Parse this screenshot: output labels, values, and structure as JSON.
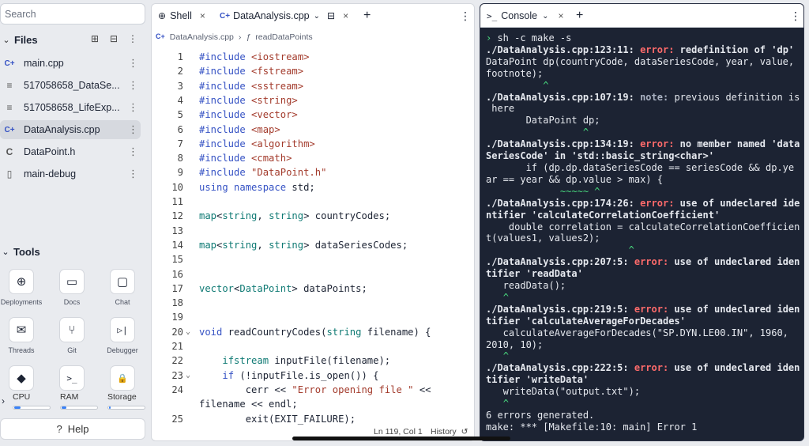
{
  "sidebar": {
    "search_placeholder": "Search",
    "files_title": "Files",
    "files": [
      {
        "icon": "cpp-icon",
        "glyph": "C+",
        "name": "main.cpp"
      },
      {
        "icon": "text-file-icon",
        "glyph": "≡",
        "name": "517058658_DataSe..."
      },
      {
        "icon": "text-file-icon",
        "glyph": "≡",
        "name": "517058658_LifeExp..."
      },
      {
        "icon": "cpp-icon",
        "glyph": "C+",
        "name": "DataAnalysis.cpp"
      },
      {
        "icon": "c-header-icon",
        "glyph": "C",
        "name": "DataPoint.h"
      },
      {
        "icon": "file-icon",
        "glyph": "▯",
        "name": "main-debug"
      }
    ],
    "tools_title": "Tools",
    "tools": [
      {
        "label": "Deployments",
        "icon": "deployments-icon",
        "glyph": "⊕"
      },
      {
        "label": "Docs",
        "icon": "docs-icon",
        "glyph": "▭"
      },
      {
        "label": "Chat",
        "icon": "chat-icon",
        "glyph": "▢"
      },
      {
        "label": "Threads",
        "icon": "threads-icon",
        "glyph": "✉"
      },
      {
        "label": "Git",
        "icon": "git-icon",
        "glyph": "⑂"
      },
      {
        "label": "Debugger",
        "icon": "debugger-icon",
        "glyph": "▷|"
      },
      {
        "label": "",
        "icon": "package-icon",
        "glyph": "◆"
      },
      {
        "label": "",
        "icon": "shell-icon",
        "glyph": ">_"
      },
      {
        "label": "",
        "icon": "lock-icon",
        "glyph": "🔒"
      }
    ],
    "meters": [
      {
        "label": "CPU",
        "fill": 0.18
      },
      {
        "label": "RAM",
        "fill": 0.14
      },
      {
        "label": "Storage",
        "fill": 0.04
      }
    ],
    "help_label": "Help"
  },
  "editor": {
    "tabs": [
      {
        "label": "Shell",
        "icon": "shell-tab-icon"
      },
      {
        "label": "DataAnalysis.cpp",
        "icon": "cpp-tab-icon"
      }
    ],
    "breadcrumb_file": "DataAnalysis.cpp",
    "breadcrumb_symbol": "readDataPoints",
    "status_position": "Ln 119, Col 1",
    "status_history": "History",
    "lines": [
      {
        "n": "1",
        "html": "<span class='kw'>#include</span> <span class='st'>&lt;iostream&gt;</span>"
      },
      {
        "n": "2",
        "html": "<span class='kw'>#include</span> <span class='st'>&lt;fstream&gt;</span>"
      },
      {
        "n": "3",
        "html": "<span class='kw'>#include</span> <span class='st'>&lt;sstream&gt;</span>"
      },
      {
        "n": "4",
        "html": "<span class='kw'>#include</span> <span class='st'>&lt;string&gt;</span>"
      },
      {
        "n": "5",
        "html": "<span class='kw'>#include</span> <span class='st'>&lt;vector&gt;</span>"
      },
      {
        "n": "6",
        "html": "<span class='kw'>#include</span> <span class='st'>&lt;map&gt;</span>"
      },
      {
        "n": "7",
        "html": "<span class='kw'>#include</span> <span class='st'>&lt;algorithm&gt;</span>"
      },
      {
        "n": "8",
        "html": "<span class='kw'>#include</span> <span class='st'>&lt;cmath&gt;</span>"
      },
      {
        "n": "9",
        "html": "<span class='kw'>#include</span> <span class='st'>\"DataPoint.h\"</span>"
      },
      {
        "n": "10",
        "html": "<span class='kw'>using namespace</span> std;"
      },
      {
        "n": "11",
        "html": ""
      },
      {
        "n": "12",
        "html": "<span class='ty'>map</span>&lt;<span class='ty'>string</span>, <span class='ty'>string</span>&gt; countryCodes;"
      },
      {
        "n": "13",
        "html": ""
      },
      {
        "n": "14",
        "html": "<span class='ty'>map</span>&lt;<span class='ty'>string</span>, <span class='ty'>string</span>&gt; dataSeriesCodes;"
      },
      {
        "n": "15",
        "html": ""
      },
      {
        "n": "16",
        "html": ""
      },
      {
        "n": "17",
        "html": "<span class='ty'>vector</span>&lt;<span class='ty'>DataPoint</span>&gt; dataPoints;"
      },
      {
        "n": "18",
        "html": ""
      },
      {
        "n": "19",
        "html": ""
      },
      {
        "n": "20",
        "html": "<span class='kw'>void</span> readCountryCodes(<span class='ty'>string</span> filename) {",
        "fold": true
      },
      {
        "n": "21",
        "html": ""
      },
      {
        "n": "22",
        "html": "    <span class='ty'>ifstream</span> inputFile(filename);"
      },
      {
        "n": "23",
        "html": "    <span class='kw'>if</span> (!inputFile.is_open()) {",
        "fold": true
      },
      {
        "n": "24",
        "html": "        cerr &lt;&lt; <span class='st'>\"Error opening file \"</span> &lt;&lt;"
      },
      {
        "n": "",
        "html": "filename &lt;&lt; endl;",
        "wrap": true
      },
      {
        "n": "25",
        "html": "        exit(EXIT_FAILURE);"
      }
    ]
  },
  "console": {
    "tab_label": "Console",
    "output_html": "<span class='gr'>›</span> sh -c make -s\n<span class='bd'>./DataAnalysis.cpp:123:11: </span><span class='err'>error: </span><span class='bd'>redefinition of 'dp'</span>\nDataPoint dp(countryCode, dataSeriesCode, year, value,\nfootnote);\n          <span class='gr'>^</span>\n<span class='bd'>./DataAnalysis.cpp:107:19: </span><span class='note'>note: </span>previous definition is\n here\n       DataPoint dp;\n                 <span class='gr'>^</span>\n<span class='bd'>./DataAnalysis.cpp:134:19: </span><span class='err'>error: </span><span class='bd'>no member named 'data\nSeriesCode' in 'std::basic_string&lt;char&gt;'</span>\n       if (dp.dp.dataSeriesCode == seriesCode &amp;&amp; dp.ye\nar == year &amp;&amp; dp.value &gt; max) {\n             <span class='gr'>~~~~~ ^</span>\n<span class='bd'>./DataAnalysis.cpp:174:26: </span><span class='err'>error: </span><span class='bd'>use of undeclared ide\nntifier 'calculateCorrelationCoefficient'</span>\n    double correlation = calculateCorrelationCoefficien\nt(values1, values2);\n                         <span class='gr'>^</span>\n<span class='bd'>./DataAnalysis.cpp:207:5: </span><span class='err'>error: </span><span class='bd'>use of undeclared iden\ntifier 'readData'</span>\n   readData();\n   <span class='gr'>^</span>\n<span class='bd'>./DataAnalysis.cpp:219:5: </span><span class='err'>error: </span><span class='bd'>use of undeclared iden\ntifier 'calculateAverageForDecades'</span>\n   calculateAverageForDecades(\"SP.DYN.LE00.IN\", 1960,\n2010, 10);\n   <span class='gr'>^</span>\n<span class='bd'>./DataAnalysis.cpp:222:5: </span><span class='err'>error: </span><span class='bd'>use of undeclared iden\ntifier 'writeData'</span>\n   writeData(\"output.txt\");\n   <span class='gr'>^</span>\n6 errors generated.\nmake: *** [Makefile:10: main] Error 1"
  }
}
